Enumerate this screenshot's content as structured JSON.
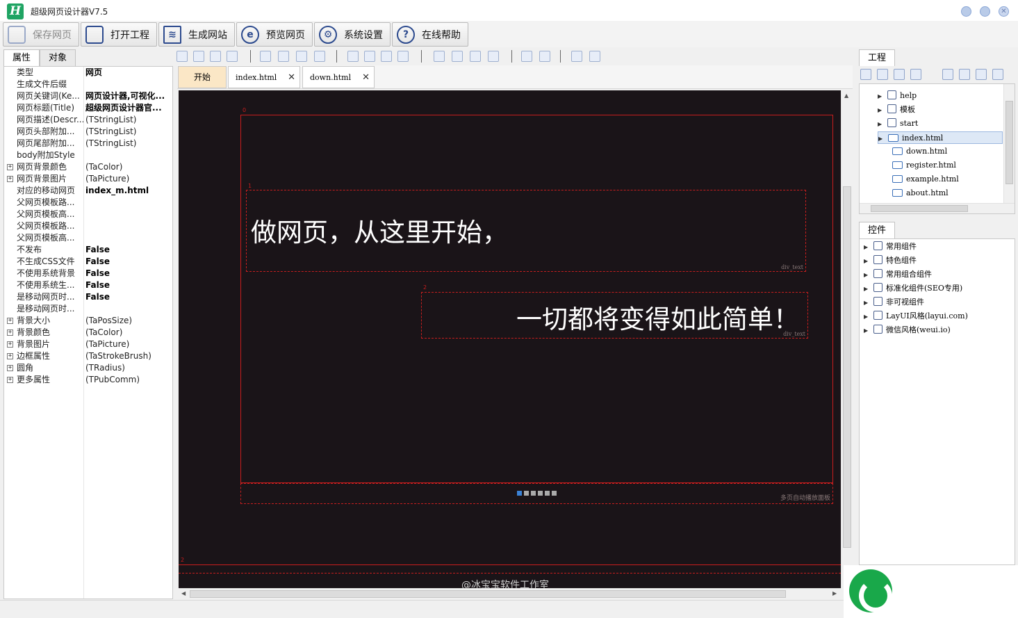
{
  "window": {
    "title": "超级网页设计器V7.5",
    "logo_letter": "H"
  },
  "toolbar": {
    "buttons": [
      {
        "label": "保存网页",
        "disabled": true
      },
      {
        "label": "打开工程"
      },
      {
        "label": "生成网站"
      },
      {
        "label": "预览网页"
      },
      {
        "label": "系统设置"
      },
      {
        "label": "在线帮助"
      }
    ]
  },
  "left_panel": {
    "tabs": [
      "属性",
      "对象"
    ],
    "properties": [
      {
        "name": "类型",
        "value": "网页",
        "bold": true
      },
      {
        "name": "生成文件后缀",
        "value": ""
      },
      {
        "name": "网页关键词(Ke...",
        "value": "网页设计器,可视化...",
        "bold": true
      },
      {
        "name": "网页标题(Title)",
        "value": "超级网页设计器官...",
        "bold": true
      },
      {
        "name": "网页描述(Descr...",
        "value": "(TStringList)"
      },
      {
        "name": "网页头部附加...",
        "value": "(TStringList)"
      },
      {
        "name": "网页尾部附加...",
        "value": "(TStringList)"
      },
      {
        "name": "body附加Style",
        "value": ""
      },
      {
        "name": "网页背景颜色",
        "value": "(TaColor)",
        "expand": true
      },
      {
        "name": "网页背景图片",
        "value": "(TaPicture)",
        "expand": true
      },
      {
        "name": "对应的移动网页",
        "value": "index_m.html",
        "bold": true
      },
      {
        "name": "父网页模板路...",
        "value": ""
      },
      {
        "name": "父网页模板高...",
        "value": ""
      },
      {
        "name": "父网页模板路...",
        "value": ""
      },
      {
        "name": "父网页模板高...",
        "value": ""
      },
      {
        "name": "不发布",
        "value": "False",
        "bold": true
      },
      {
        "name": "不生成CSS文件",
        "value": "False",
        "bold": true
      },
      {
        "name": "不使用系统背景",
        "value": "False",
        "bold": true
      },
      {
        "name": "不使用系统生...",
        "value": "False",
        "bold": true
      },
      {
        "name": "是移动网页时...",
        "value": "False",
        "bold": true
      },
      {
        "name": "是移动网页时...",
        "value": ""
      },
      {
        "name": "背景大小",
        "value": "(TaPosSize)",
        "expand": true
      },
      {
        "name": "背景颜色",
        "value": "(TaColor)",
        "expand": true
      },
      {
        "name": "背景图片",
        "value": "(TaPicture)",
        "expand": true
      },
      {
        "name": "边框属性",
        "value": "(TaStrokeBrush)",
        "expand": true
      },
      {
        "name": "圆角",
        "value": "(TRadius)",
        "expand": true
      },
      {
        "name": "更多属性",
        "value": "(TPubComm)",
        "expand": true
      }
    ]
  },
  "doc_tabs": [
    {
      "label": "开始"
    },
    {
      "label": "index.html",
      "closable": true
    },
    {
      "label": "down.html",
      "closable": true
    }
  ],
  "canvas": {
    "headline": "做网页，从这里开始，",
    "subline": "一切都将变得如此简单！",
    "box_tag_1": "div_text",
    "box_tag_2": "div_text",
    "carousel_tag": "多页自动播放面板",
    "marker_0": "0",
    "marker_1": "1",
    "marker_2a": "2",
    "marker_2b": "2",
    "footer": "@冰宝宝软件工作室"
  },
  "right_panel": {
    "project_tab": "工程",
    "project_tree": [
      {
        "label": "help",
        "type": "folder",
        "expandable": true
      },
      {
        "label": "模板",
        "type": "folder",
        "expandable": true
      },
      {
        "label": "start",
        "type": "folder",
        "expandable": true
      },
      {
        "label": "index.html",
        "type": "page",
        "expandable": true,
        "selected": true
      },
      {
        "label": "down.html",
        "type": "page"
      },
      {
        "label": "register.html",
        "type": "page"
      },
      {
        "label": "example.html",
        "type": "page"
      },
      {
        "label": "about.html",
        "type": "page"
      }
    ],
    "controls_tab": "控件",
    "controls_tree": [
      {
        "label": "常用组件"
      },
      {
        "label": "特色组件"
      },
      {
        "label": "常用组合组件"
      },
      {
        "label": "标准化组件(SEO专用)"
      },
      {
        "label": "非可视组件"
      },
      {
        "label": "LayUI风格(layui.com)"
      },
      {
        "label": "微信风格(weui.io)"
      }
    ]
  },
  "colors": {
    "canvas_bg": "#1a1418",
    "guide_red": "#c81e1e",
    "accent_blue": "#3b82d6",
    "brand_green": "#1fa463"
  }
}
